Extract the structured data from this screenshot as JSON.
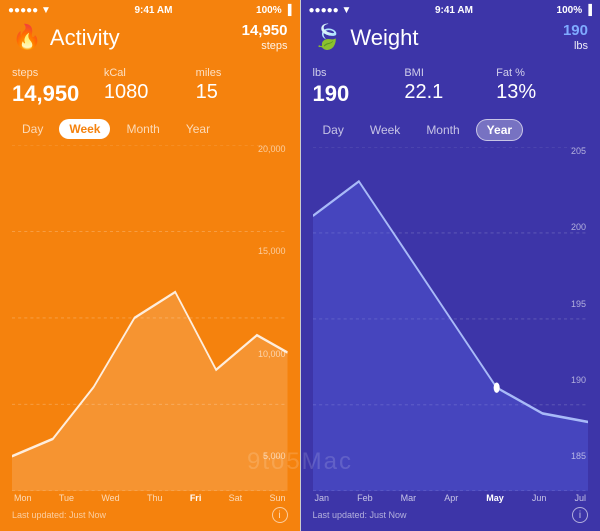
{
  "status": {
    "time": "9:41 AM",
    "battery": "100%",
    "signal": "●●●●●"
  },
  "activity": {
    "title": "Activity",
    "icon": "🔥",
    "top_value": "14,950",
    "top_unit": "steps",
    "metrics": [
      {
        "label": "steps",
        "value": "14,950"
      },
      {
        "label": "kCal",
        "value": "1080"
      },
      {
        "label": "miles",
        "value": "15"
      }
    ],
    "tabs": [
      "Day",
      "Week",
      "Month",
      "Year"
    ],
    "active_tab": "Week",
    "y_labels": [
      "20,000",
      "15,000",
      "10,000",
      "5,000"
    ],
    "x_labels": [
      "Mon",
      "Tue",
      "Wed",
      "Thu",
      "Fri",
      "Sat",
      "Sun"
    ],
    "active_x": "Fri",
    "last_updated": "Last updated: Just Now",
    "info_label": "i"
  },
  "weight": {
    "title": "Weight",
    "icon": "🍃",
    "top_value": "190",
    "top_unit": "lbs",
    "metrics": [
      {
        "label": "lbs",
        "value": "190"
      },
      {
        "label": "BMI",
        "value": "22.1"
      },
      {
        "label": "Fat %",
        "value": "13%"
      }
    ],
    "tabs": [
      "Day",
      "Week",
      "Month",
      "Year"
    ],
    "active_tab": "Year",
    "y_labels": [
      "205",
      "200",
      "195",
      "190",
      "185"
    ],
    "x_labels": [
      "Jan",
      "Feb",
      "Mar",
      "Apr",
      "May",
      "Jun",
      "Jul"
    ],
    "active_x": "May",
    "last_updated": "Last updated: Just Now",
    "info_label": "i"
  },
  "watermark": "9to5Mac"
}
